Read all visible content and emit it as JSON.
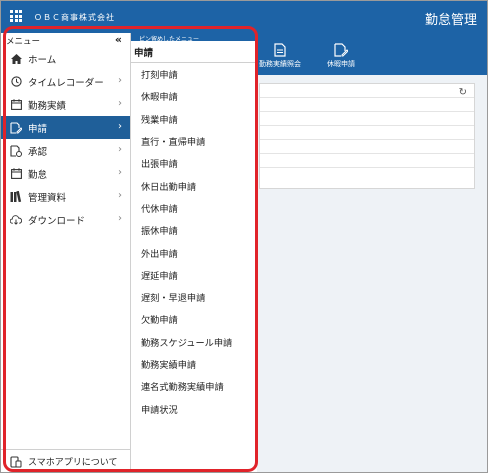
{
  "header": {
    "company": "ＯＢＣ商事株式会社",
    "app_title": "勤怠管理"
  },
  "ribbon": {
    "pin_label": "ピン留めしたメニュー",
    "buttons": [
      {
        "label": "勤務実績照会",
        "icon": "document-icon"
      },
      {
        "label": "休暇申請",
        "icon": "document-edit-icon"
      }
    ]
  },
  "sidebar": {
    "title": "メニュー",
    "collapse_glyph": "«",
    "items": [
      {
        "label": "ホーム",
        "icon": "home-icon",
        "has_chevron": false,
        "active": false
      },
      {
        "label": "タイムレコーダー",
        "icon": "clock-icon",
        "has_chevron": true,
        "active": false
      },
      {
        "label": "勤務実績",
        "icon": "calendar-icon",
        "has_chevron": true,
        "active": false
      },
      {
        "label": "申請",
        "icon": "apply-icon",
        "has_chevron": true,
        "active": true
      },
      {
        "label": "承認",
        "icon": "approve-icon",
        "has_chevron": true,
        "active": false
      },
      {
        "label": "勤怠",
        "icon": "calendar-grid-icon",
        "has_chevron": true,
        "active": false
      },
      {
        "label": "管理資料",
        "icon": "books-icon",
        "has_chevron": true,
        "active": false
      },
      {
        "label": "ダウンロード",
        "icon": "cloud-download-icon",
        "has_chevron": true,
        "active": false
      }
    ],
    "footer": {
      "label": "スマホアプリについて",
      "icon": "phone-icon"
    }
  },
  "submenu": {
    "title": "申請",
    "items": [
      "打刻申請",
      "休暇申請",
      "残業申請",
      "直行・直帰申請",
      "出張申請",
      "休日出勤申請",
      "代休申請",
      "振休申請",
      "外出申請",
      "遅延申請",
      "遅刻・早退申請",
      "欠勤申請",
      "勤務スケジュール申請",
      "勤務実績申請",
      "連名式勤務実績申請",
      "申請状況"
    ]
  },
  "colors": {
    "header_blue": "#1d63a6",
    "active_item": "#1f5f99",
    "highlight_red": "#e0232a"
  }
}
